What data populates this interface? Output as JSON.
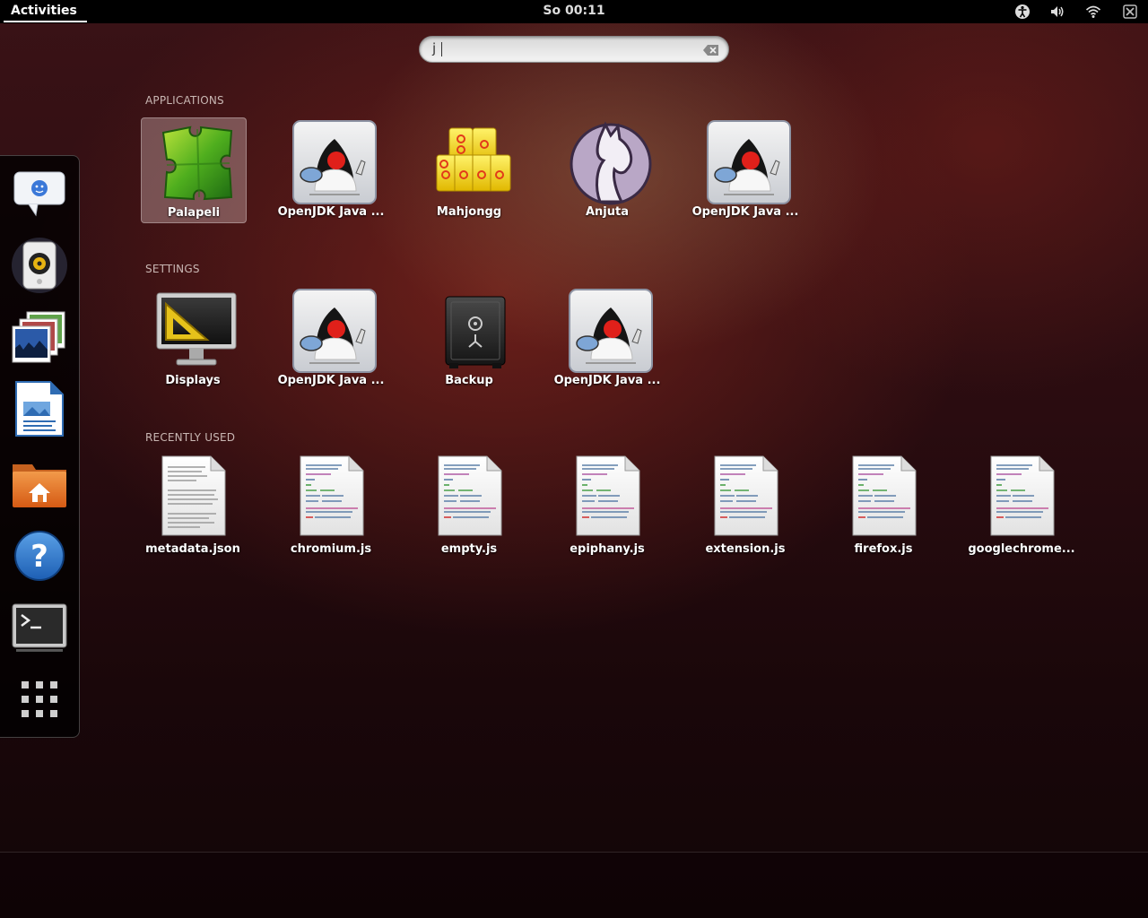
{
  "topbar": {
    "activities_label": "Activities",
    "clock": "So 00:11",
    "tray_icons": [
      "accessibility-icon",
      "volume-icon",
      "wifi-icon",
      "user-offline-icon"
    ]
  },
  "search": {
    "value": "j",
    "clear_icon": "clear-icon"
  },
  "dash": {
    "items": [
      {
        "name": "empathy",
        "icon": "chat-bubble-icon"
      },
      {
        "name": "rhythmbox",
        "icon": "speaker-icon"
      },
      {
        "name": "shotwell",
        "icon": "photos-icon"
      },
      {
        "name": "libreoffice-writer",
        "icon": "document-writer-icon"
      },
      {
        "name": "files",
        "icon": "home-folder-icon"
      },
      {
        "name": "help",
        "icon": "help-icon"
      },
      {
        "name": "terminal",
        "icon": "terminal-icon"
      },
      {
        "name": "show-applications",
        "icon": "app-grid-icon"
      }
    ]
  },
  "sections": {
    "applications": {
      "label": "APPLICATIONS",
      "items": [
        {
          "label": "Palapeli",
          "icon": "puzzle-icon"
        },
        {
          "label": "OpenJDK Java ...",
          "icon": "java-duke-icon"
        },
        {
          "label": "Mahjongg",
          "icon": "mahjongg-tiles-icon"
        },
        {
          "label": "Anjuta",
          "icon": "horse-icon"
        },
        {
          "label": "OpenJDK Java ...",
          "icon": "java-duke-icon"
        }
      ]
    },
    "settings": {
      "label": "SETTINGS",
      "items": [
        {
          "label": "Displays",
          "icon": "display-monitor-icon"
        },
        {
          "label": "OpenJDK Java ...",
          "icon": "java-duke-icon"
        },
        {
          "label": "Backup",
          "icon": "safe-icon"
        },
        {
          "label": "OpenJDK Java ...",
          "icon": "java-duke-icon"
        }
      ]
    },
    "recent": {
      "label": "RECENTLY USED",
      "items": [
        {
          "label": "metadata.json",
          "icon": "text-file-icon"
        },
        {
          "label": "chromium.js",
          "icon": "script-file-icon"
        },
        {
          "label": "empty.js",
          "icon": "script-file-icon"
        },
        {
          "label": "epiphany.js",
          "icon": "script-file-icon"
        },
        {
          "label": "extension.js",
          "icon": "script-file-icon"
        },
        {
          "label": "firefox.js",
          "icon": "script-file-icon"
        },
        {
          "label": "googlechrome...",
          "icon": "script-file-icon"
        }
      ]
    }
  }
}
